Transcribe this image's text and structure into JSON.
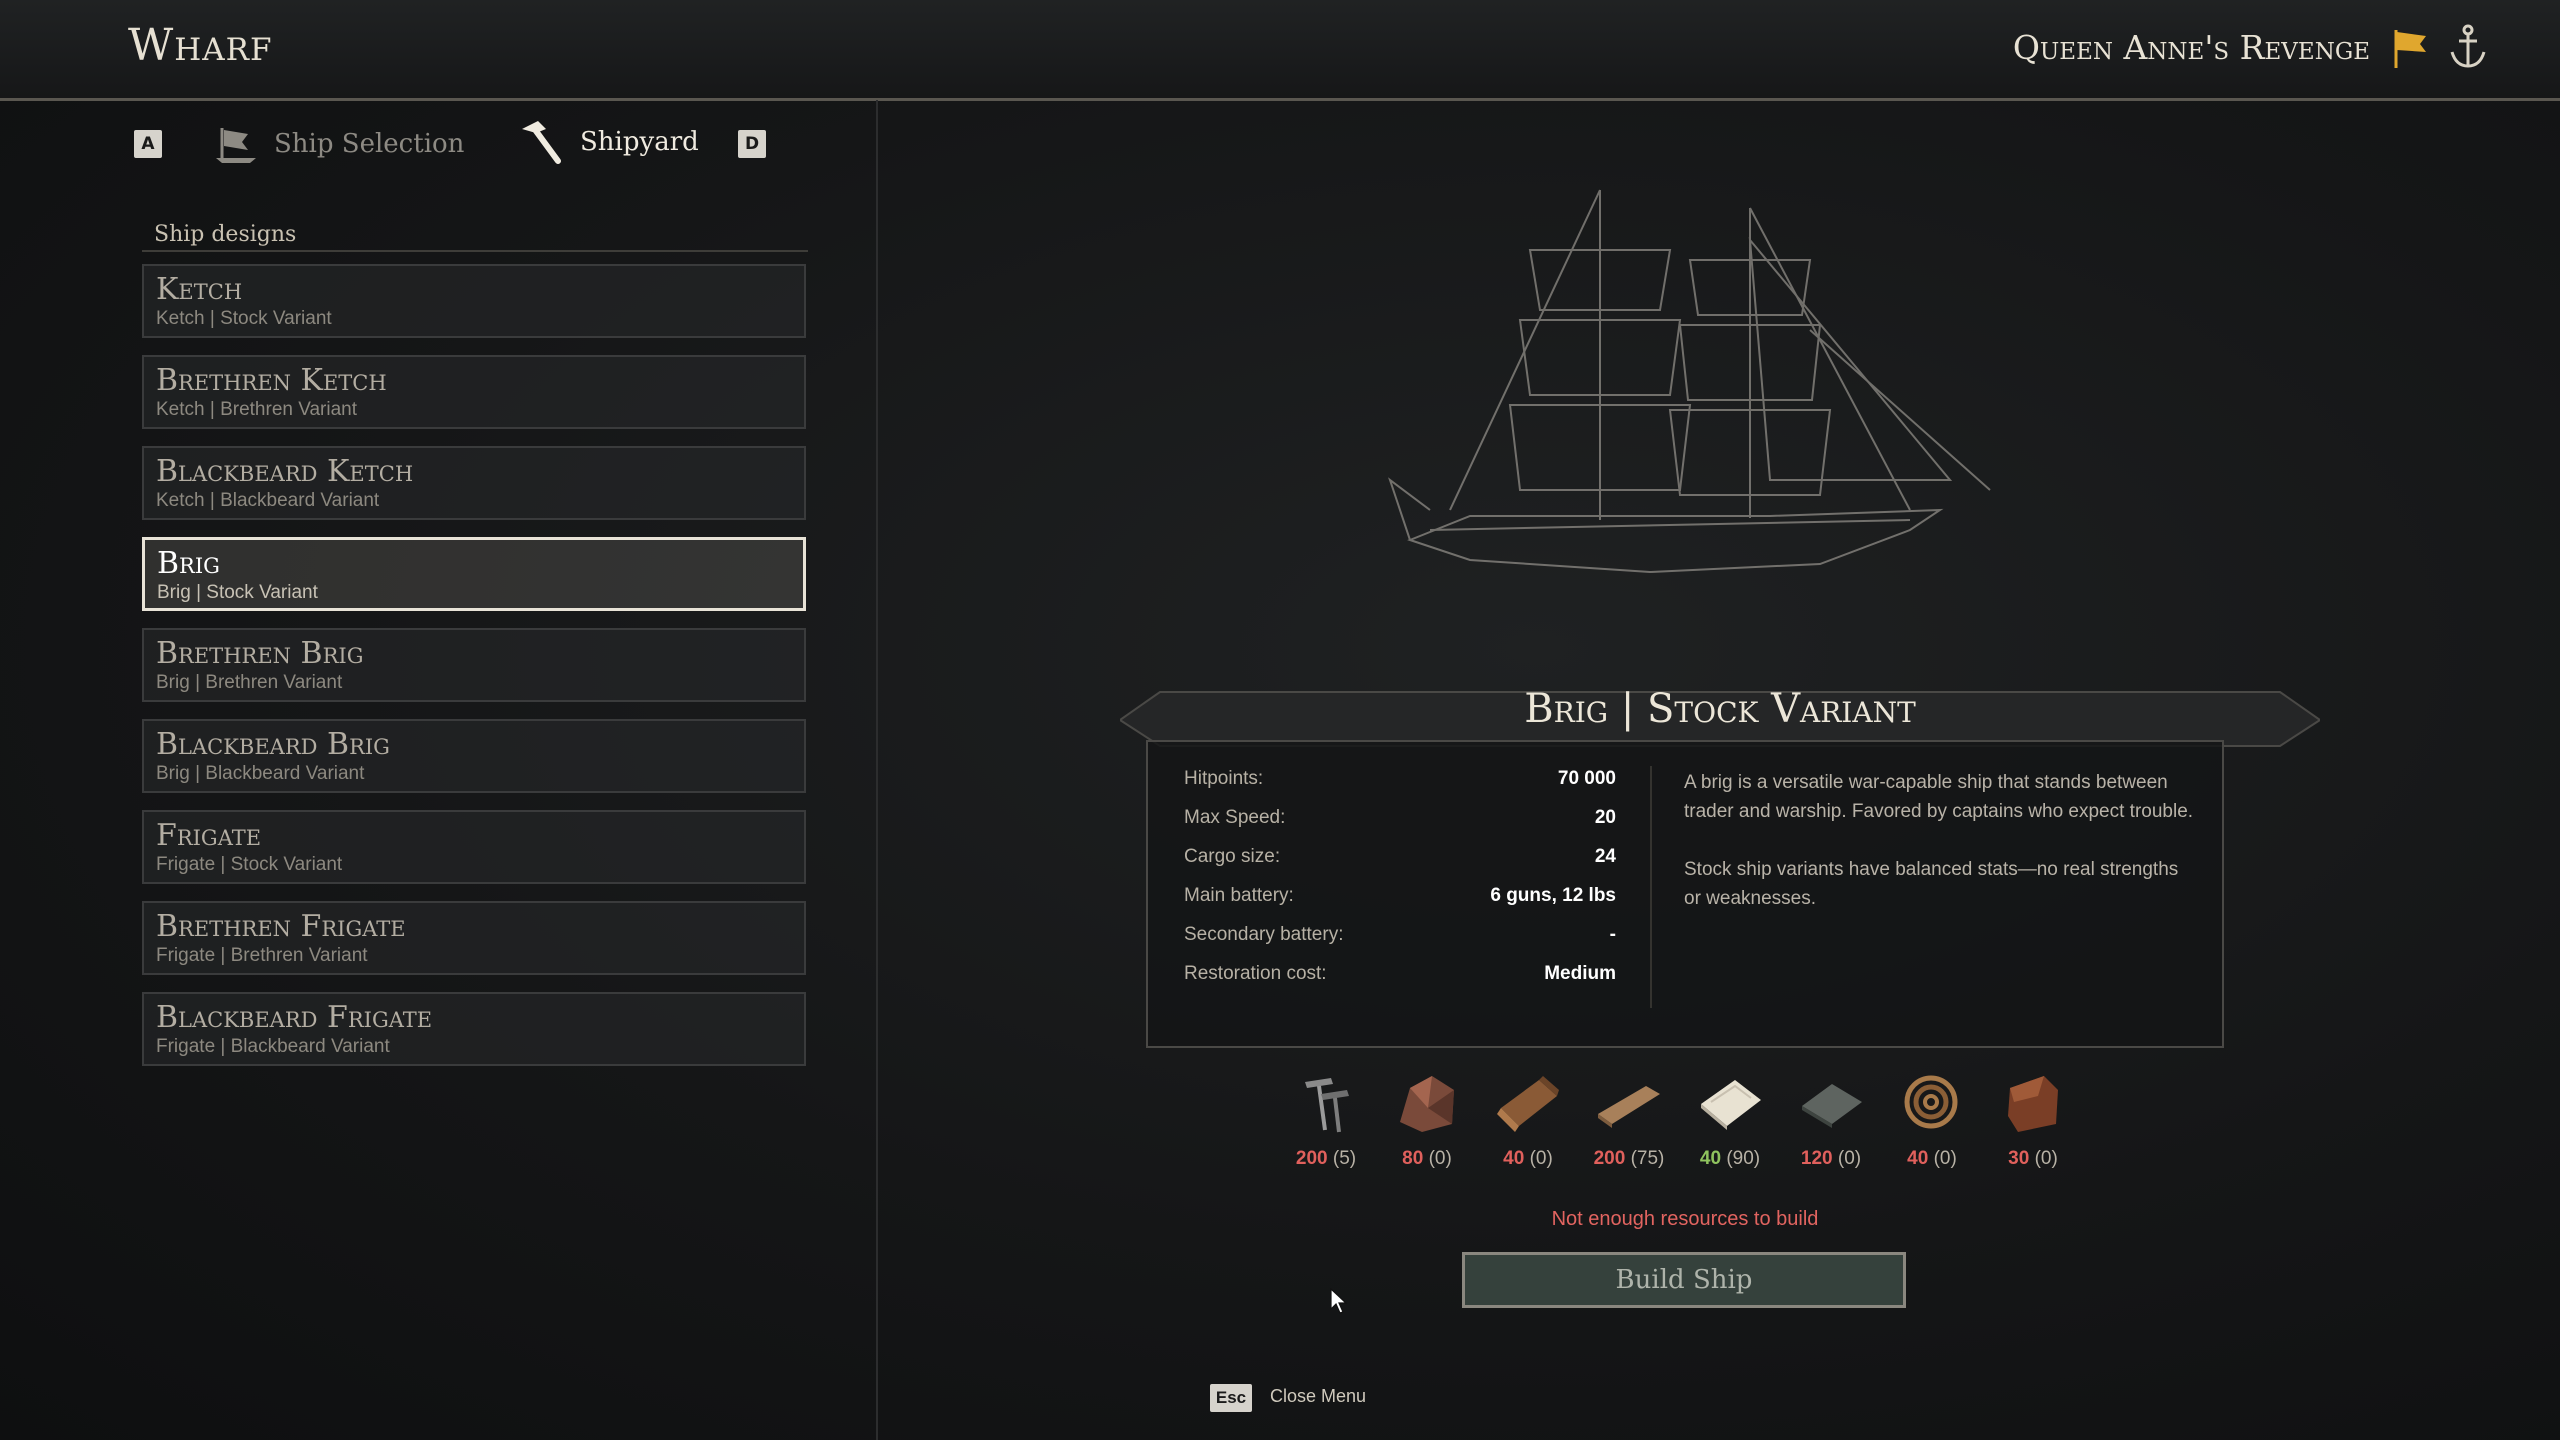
{
  "header": {
    "title": "Wharf",
    "ship_name": "Queen Anne's Revenge"
  },
  "tabs": {
    "prev_key": "A",
    "next_key": "D",
    "ship_selection_label": "Ship Selection",
    "shipyard_label": "Shipyard",
    "active": "Shipyard"
  },
  "designs": {
    "heading": "Ship designs",
    "items": [
      {
        "name": "Ketch",
        "subtitle": "Ketch | Stock Variant"
      },
      {
        "name": "Brethren Ketch",
        "subtitle": "Ketch | Brethren Variant"
      },
      {
        "name": "Blackbeard Ketch",
        "subtitle": "Ketch | Blackbeard Variant"
      },
      {
        "name": "Brig",
        "subtitle": "Brig | Stock Variant"
      },
      {
        "name": "Brethren Brig",
        "subtitle": "Brig | Brethren Variant"
      },
      {
        "name": "Blackbeard Brig",
        "subtitle": "Brig | Blackbeard Variant"
      },
      {
        "name": "Frigate",
        "subtitle": "Frigate | Stock Variant"
      },
      {
        "name": "Brethren Frigate",
        "subtitle": "Frigate | Brethren Variant"
      },
      {
        "name": "Blackbeard Frigate",
        "subtitle": "Frigate | Blackbeard Variant"
      }
    ],
    "selected_index": 3
  },
  "details": {
    "title": "Brig | Stock Variant",
    "stats": [
      {
        "label": "Hitpoints:",
        "value": "70 000"
      },
      {
        "label": "Max Speed:",
        "value": "20"
      },
      {
        "label": "Cargo size:",
        "value": "24"
      },
      {
        "label": "Main battery:",
        "value": "6 guns, 12 lbs"
      },
      {
        "label": "Secondary battery:",
        "value": "-"
      },
      {
        "label": "Restoration cost:",
        "value": "Medium"
      }
    ],
    "description": [
      "A brig is a versatile war-capable ship that stands between trader and warship. Favored by captains who expect trouble.",
      "Stock ship variants have balanced stats—no real strengths or weaknesses."
    ]
  },
  "resources": [
    {
      "icon": "nails-icon",
      "required": "200",
      "owned": "(5)",
      "status": "insufficient"
    },
    {
      "icon": "ore-icon",
      "required": "80",
      "owned": "(0)",
      "status": "insufficient"
    },
    {
      "icon": "timber-log-icon",
      "required": "40",
      "owned": "(0)",
      "status": "insufficient"
    },
    {
      "icon": "plank-icon",
      "required": "200",
      "owned": "(75)",
      "status": "insufficient"
    },
    {
      "icon": "canvas-sail-icon",
      "required": "40",
      "owned": "(90)",
      "status": "sufficient"
    },
    {
      "icon": "metal-plate-icon",
      "required": "120",
      "owned": "(0)",
      "status": "insufficient"
    },
    {
      "icon": "rope-icon",
      "required": "40",
      "owned": "(0)",
      "status": "insufficient"
    },
    {
      "icon": "leather-icon",
      "required": "30",
      "owned": "(0)",
      "status": "insufficient"
    }
  ],
  "warning": "Not enough resources to build",
  "build_button": "Build Ship",
  "footer": {
    "key": "Esc",
    "label": "Close Menu"
  },
  "colors": {
    "insufficient": "#e0605c",
    "sufficient": "#8fc35e",
    "accent_flag": "#e0a72e"
  }
}
